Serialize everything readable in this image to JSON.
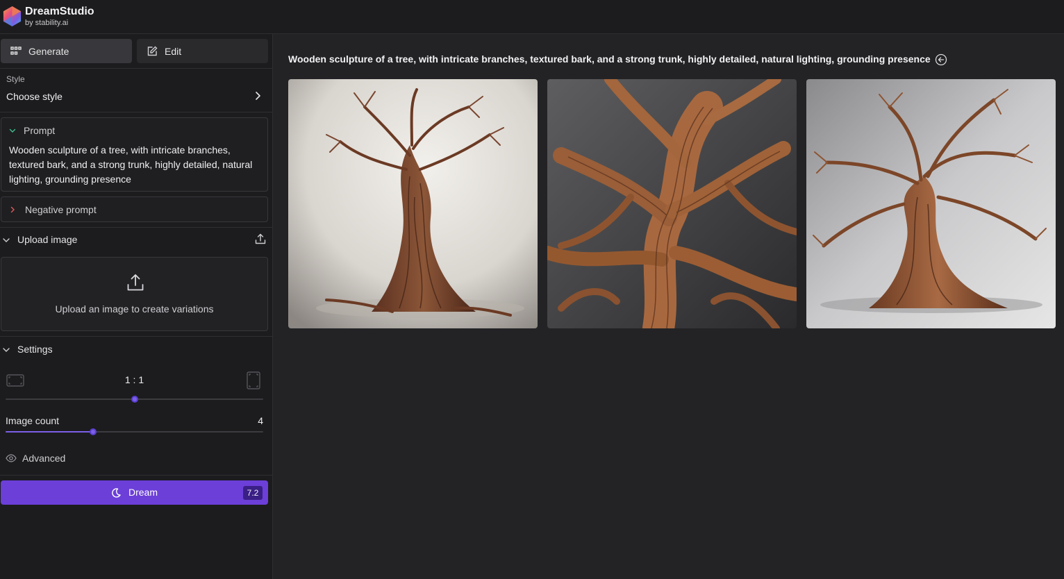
{
  "brand": {
    "name": "DreamStudio",
    "sub": "by stability.ai"
  },
  "tabs": {
    "generate": "Generate",
    "edit": "Edit"
  },
  "style": {
    "label": "Style",
    "value": "Choose style"
  },
  "prompt": {
    "title": "Prompt",
    "text": "Wooden sculpture of a tree, with intricate branches, textured bark, and a strong trunk, highly detailed, natural lighting, grounding presence"
  },
  "negative_prompt": {
    "title": "Negative prompt"
  },
  "upload": {
    "title": "Upload image",
    "box_text": "Upload an image to create variations"
  },
  "settings": {
    "title": "Settings",
    "ratio_value": "1 : 1",
    "ratio_position": 0.5,
    "image_count_label": "Image count",
    "image_count_value": "4",
    "image_count_fraction": 0.34
  },
  "advanced": {
    "label": "Advanced"
  },
  "dream": {
    "label": "Dream",
    "cost": "7.2"
  },
  "main": {
    "title": "Wooden sculpture of a tree, with intricate branches, textured bark, and a strong trunk, highly detailed, natural lighting, grounding presence",
    "images": [
      {
        "name": "generated-image-1"
      },
      {
        "name": "generated-image-2"
      },
      {
        "name": "generated-image-3"
      }
    ]
  },
  "icons": {
    "logo": "stability-hexagon-logo",
    "generate": "grid-icon",
    "edit": "pencil-square-icon",
    "style_chevron": "chevron-right-icon",
    "upload": "upload-icon",
    "advanced": "eye-icon",
    "dream": "moon-icon",
    "back": "arrow-left-circle-icon"
  },
  "colors": {
    "accent": "#6c3fd8",
    "slider": "#7c5ee8",
    "background": "#232326",
    "sidebar": "#1c1c1e"
  }
}
